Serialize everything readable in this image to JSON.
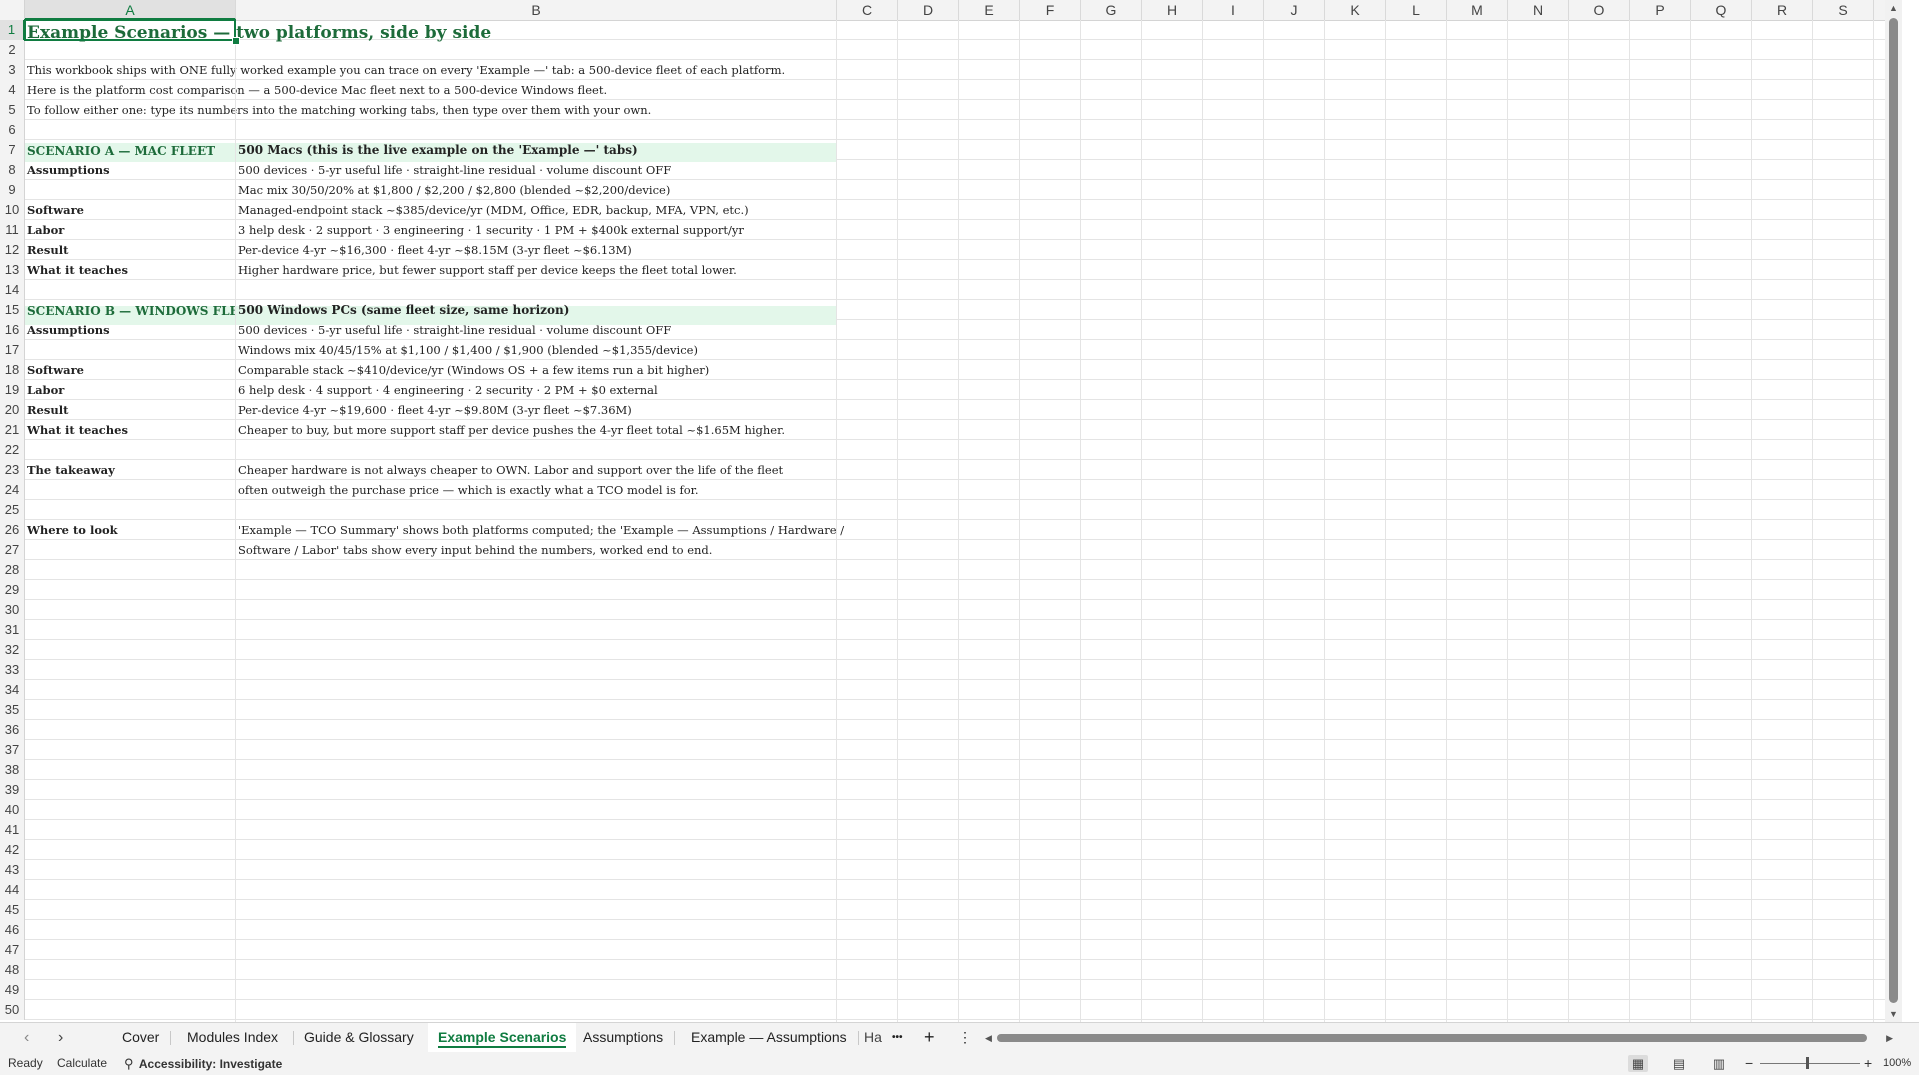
{
  "columns": [
    "A",
    "B",
    "C",
    "D",
    "E",
    "F",
    "G",
    "H",
    "I",
    "J",
    "K",
    "L",
    "M",
    "N",
    "O",
    "P",
    "Q",
    "R",
    "S"
  ],
  "rows": [
    "1",
    "2",
    "3",
    "4",
    "5",
    "6",
    "7",
    "8",
    "9",
    "10",
    "11",
    "12",
    "13",
    "14",
    "15",
    "16",
    "17",
    "18",
    "19",
    "20",
    "21",
    "22",
    "23",
    "24",
    "25",
    "26",
    "27",
    "28",
    "29",
    "30",
    "31",
    "32",
    "33",
    "34",
    "35",
    "36",
    "37",
    "38",
    "39",
    "40",
    "41",
    "42",
    "43",
    "44",
    "45",
    "46",
    "47",
    "48",
    "49",
    "50"
  ],
  "cells": {
    "a1": "Example Scenarios — two platforms, side by side",
    "a3": "This workbook ships with ONE fully worked example you can trace on every 'Example —' tab: a 500-device fleet of each platform.",
    "a4": "Here is the platform cost comparison — a 500-device Mac fleet next to a 500-device Windows fleet.",
    "a5": "To follow either one: type its numbers into the matching working tabs, then type over them with your own.",
    "a7": "SCENARIO A — MAC FLEET",
    "b7": "500 Macs  (this is the live example on the 'Example —' tabs)",
    "a8": "Assumptions",
    "b8": "500 devices · 5-yr useful life · straight-line residual · volume discount OFF",
    "b9": "Mac mix 30/50/20% at $1,800 / $2,200 / $2,800 (blended ~$2,200/device)",
    "a10": "Software",
    "b10": "Managed-endpoint stack ~$385/device/yr (MDM, Office, EDR, backup, MFA, VPN, etc.)",
    "a11": "Labor",
    "b11": "3 help desk · 2 support · 3 engineering · 1 security · 1 PM + $400k external support/yr",
    "a12": "Result",
    "b12": "Per-device 4-yr ~$16,300 · fleet 4-yr ~$8.15M (3-yr fleet ~$6.13M)",
    "a13": "What it teaches",
    "b13": "Higher hardware price, but fewer support staff per device keeps the fleet total lower.",
    "a15": "SCENARIO B — WINDOWS FLEET",
    "b15": "500 Windows PCs  (same fleet size, same horizon)",
    "a16": "Assumptions",
    "b16": "500 devices · 5-yr useful life · straight-line residual · volume discount OFF",
    "b17": "Windows mix 40/45/15% at $1,100 / $1,400 / $1,900 (blended ~$1,355/device)",
    "a18": "Software",
    "b18": "Comparable stack ~$410/device/yr (Windows OS + a few items run a bit higher)",
    "a19": "Labor",
    "b19": "6 help desk · 4 support · 4 engineering · 2 security · 2 PM + $0 external",
    "a20": "Result",
    "b20": "Per-device 4-yr ~$19,600 · fleet 4-yr ~$9.80M (3-yr fleet ~$7.36M)",
    "a21": "What it teaches",
    "b21": "Cheaper to buy, but more support staff per device pushes the 4-yr fleet total ~$1.65M higher.",
    "a23": "The takeaway",
    "b23": "Cheaper hardware is not always cheaper to OWN. Labor and support over the life of the fleet",
    "b24": "often outweigh the purchase price — which is exactly what a TCO model is for.",
    "a26": "Where to look",
    "b26": "'Example — TCO Summary' shows both platforms computed; the 'Example — Assumptions / Hardware /",
    "b27": "Software / Labor' tabs show every input behind the numbers, worked end to end."
  },
  "tabs": {
    "t1": "Cover",
    "t2": "Modules Index",
    "t3": "Guide & Glossary",
    "t4": "Example Scenarios",
    "t5": "Assumptions",
    "t6": "Example — Assumptions",
    "t7": "Ha",
    "more": "•••",
    "add": "+",
    "menu": "⋮"
  },
  "status": {
    "ready": "Ready",
    "calculate": "Calculate",
    "accessibility": "Accessibility: Investigate",
    "zoom": "100%",
    "zoom_out": "−",
    "zoom_in": "+"
  },
  "icons": [
    "accessibility-icon",
    "normal-view-icon",
    "page-layout-icon",
    "page-break-icon",
    "scroll-left-icon",
    "scroll-right-icon"
  ],
  "colors": {
    "accent": "#107c41",
    "band": "#e3f7ea",
    "title_text": "#1d6b3a"
  }
}
